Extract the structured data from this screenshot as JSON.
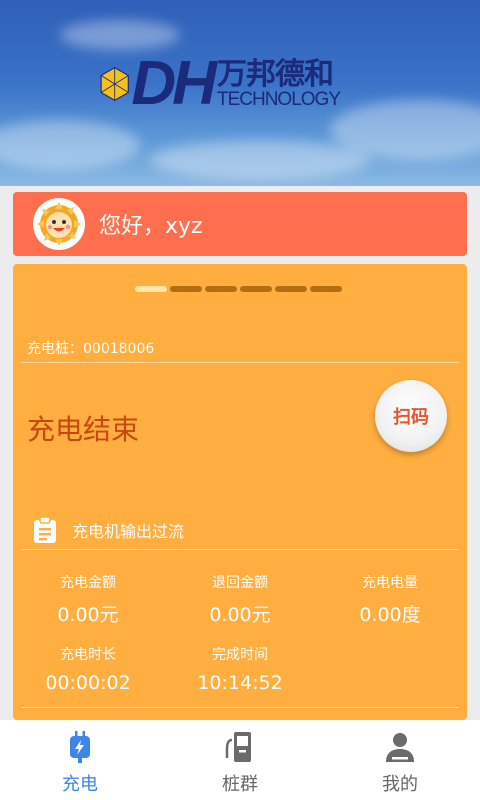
{
  "banner": {
    "logo_mark": "DH",
    "logo_cn": "万邦德和",
    "logo_en": "TECHNOLOGY"
  },
  "greeting": {
    "text": "您好，xyz",
    "avatar_icon": "sun-avatar-icon"
  },
  "card": {
    "pager": {
      "count": 6,
      "active_index": 0
    },
    "pile_id": "充电桩：00018006",
    "status": "充电结束",
    "scan_button_label": "扫码",
    "message_icon": "clipboard-icon",
    "message": "充电机输出过流",
    "stats": [
      {
        "label": "充电金额",
        "value": "0.00元"
      },
      {
        "label": "退回金额",
        "value": "0.00元"
      },
      {
        "label": "充电电量",
        "value": "0.00度"
      },
      {
        "label": "充电时长",
        "value": "00:00:02"
      },
      {
        "label": "完成时间",
        "value": "10:14:52"
      }
    ]
  },
  "nav": {
    "items": [
      {
        "label": "充电",
        "icon": "charging-plug-icon",
        "active": true
      },
      {
        "label": "桩群",
        "icon": "charging-station-icon",
        "active": false
      },
      {
        "label": "我的",
        "icon": "user-profile-icon",
        "active": false
      }
    ]
  },
  "colors": {
    "greeting_bg": "#ff6f4d",
    "card_bg": "#ffae3f",
    "status_text": "#c9480e",
    "nav_active": "#3d86e8"
  }
}
